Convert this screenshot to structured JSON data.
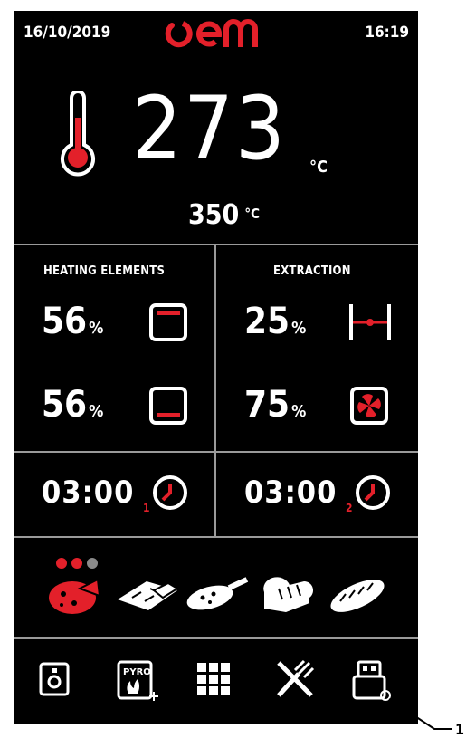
{
  "status": {
    "date": "16/10/2019",
    "time": "16:19",
    "logo": "oem"
  },
  "temperature": {
    "current": "273",
    "current_unit": "°C",
    "set": "350",
    "set_unit": "°C"
  },
  "heating": {
    "title": "HEATING ELEMENTS",
    "top": {
      "value": "56",
      "unit": "%"
    },
    "bottom": {
      "value": "56",
      "unit": "%"
    }
  },
  "extraction": {
    "title": "EXTRACTION",
    "valve": {
      "value": "25",
      "unit": "%"
    },
    "fan": {
      "value": "75",
      "unit": "%"
    }
  },
  "timers": [
    {
      "value": "03:00",
      "index": "1"
    },
    {
      "value": "03:00",
      "index": "2"
    }
  ],
  "programs": [
    "pizza-icon",
    "focaccia-tray-icon",
    "pizza-peel-icon",
    "bread-loaf-icon",
    "baguette-icon"
  ],
  "toolbar": {
    "buttons": [
      "oven-door-icon",
      "pyro-cleaning-icon",
      "apps-grid-icon",
      "tools-icon",
      "usb-icon"
    ],
    "pyro_label": "PYRO"
  },
  "callout": "1",
  "colors": {
    "accent": "#e3202a",
    "background": "#000000",
    "divider": "#9a9a9a"
  }
}
